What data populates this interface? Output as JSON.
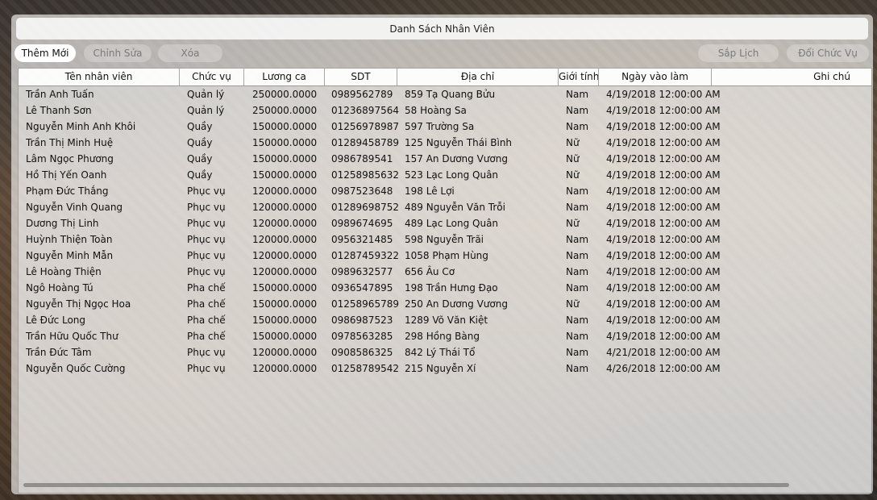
{
  "window": {
    "title": "Danh Sách Nhân Viên"
  },
  "toolbar": {
    "add_label": "Thêm Mới",
    "edit_label": "Chỉnh Sửa",
    "delete_label": "Xóa",
    "schedule_label": "Sắp Lịch",
    "change_role_label": "Đổi Chức Vụ"
  },
  "table": {
    "columns": [
      "Tên nhân viên",
      "Chức vụ",
      "Lương ca",
      "SDT",
      "Địa chỉ",
      "Giới tính",
      "Ngày vào làm",
      "Ghi chú"
    ],
    "rows": [
      [
        "Trần Anh Tuấn",
        "Quản lý",
        "250000.0000",
        "0989562789",
        "859 Tạ Quang Bửu",
        "Nam",
        "4/19/2018 12:00:00 AM",
        ""
      ],
      [
        "Lê Thanh Sơn",
        "Quản lý",
        "250000.0000",
        "01236897564",
        "58 Hoàng Sa",
        "Nam",
        "4/19/2018 12:00:00 AM",
        ""
      ],
      [
        "Nguyễn Minh Anh Khôi",
        "Quầy",
        "150000.0000",
        "01256978987",
        "597 Trường Sa",
        "Nam",
        "4/19/2018 12:00:00 AM",
        ""
      ],
      [
        "Trần Thị Minh Huệ",
        "Quầy",
        "150000.0000",
        "01289458789",
        "125 Nguyễn Thái Bình",
        "Nữ",
        "4/19/2018 12:00:00 AM",
        ""
      ],
      [
        "Lâm Ngọc Phương",
        "Quầy",
        "150000.0000",
        "0986789541",
        "157 An Dương Vương",
        "Nữ",
        "4/19/2018 12:00:00 AM",
        ""
      ],
      [
        "Hồ Thị Yến Oanh",
        "Quầy",
        "150000.0000",
        "01258985632",
        "523 Lạc Long Quân",
        "Nữ",
        "4/19/2018 12:00:00 AM",
        ""
      ],
      [
        "Phạm Đức Thắng",
        "Phục vụ",
        "120000.0000",
        "0987523648",
        "198 Lê Lợi",
        "Nam",
        "4/19/2018 12:00:00 AM",
        ""
      ],
      [
        "Nguyễn Vinh Quang",
        "Phục vụ",
        "120000.0000",
        "01289698752",
        "489 Nguyễn Văn Trỗi",
        "Nam",
        "4/19/2018 12:00:00 AM",
        ""
      ],
      [
        "Dương Thị Linh",
        "Phục vụ",
        "120000.0000",
        "0989674695",
        "489 Lạc Long Quân",
        "Nữ",
        "4/19/2018 12:00:00 AM",
        ""
      ],
      [
        "Huỳnh Thiện Toàn",
        "Phục vụ",
        "120000.0000",
        "0956321485",
        "598 Nguyễn Trãi",
        "Nam",
        "4/19/2018 12:00:00 AM",
        ""
      ],
      [
        "Nguyễn Minh Mẫn",
        "Phục vụ",
        "120000.0000",
        "01287459322",
        "1058 Phạm Hùng",
        "Nam",
        "4/19/2018 12:00:00 AM",
        ""
      ],
      [
        "Lê Hoàng Thiện",
        "Phục vụ",
        "120000.0000",
        "0989632577",
        "656 Âu Cơ",
        "Nam",
        "4/19/2018 12:00:00 AM",
        ""
      ],
      [
        "Ngô Hoàng Tú",
        "Pha chế",
        "150000.0000",
        "0936547895",
        "198 Trần Hưng Đạo",
        "Nam",
        "4/19/2018 12:00:00 AM",
        ""
      ],
      [
        "Nguyễn Thị Ngọc Hoa",
        "Pha chế",
        "150000.0000",
        "01258965789",
        "250 An Dương Vương",
        "Nữ",
        "4/19/2018 12:00:00 AM",
        ""
      ],
      [
        "Lê Đức Long",
        "Pha chế",
        "150000.0000",
        "0986987523",
        "1289 Võ Văn Kiệt",
        "Nam",
        "4/19/2018 12:00:00 AM",
        ""
      ],
      [
        "Trần Hữu Quốc Thư",
        "Pha chế",
        "150000.0000",
        "0978563285",
        "298 Hồng Bàng",
        "Nam",
        "4/19/2018 12:00:00 AM",
        ""
      ],
      [
        "Trần Đức Tâm",
        "Phục vụ",
        "120000.0000",
        "0908586325",
        "842 Lý Thái Tổ",
        "Nam",
        "4/21/2018 12:00:00 AM",
        ""
      ],
      [
        "Nguyễn Quốc Cường",
        "Phục vụ",
        "120000.0000",
        "01258789542",
        "215 Nguyễn Xí",
        "Nam",
        "4/26/2018 12:00:00 AM",
        ""
      ]
    ]
  }
}
